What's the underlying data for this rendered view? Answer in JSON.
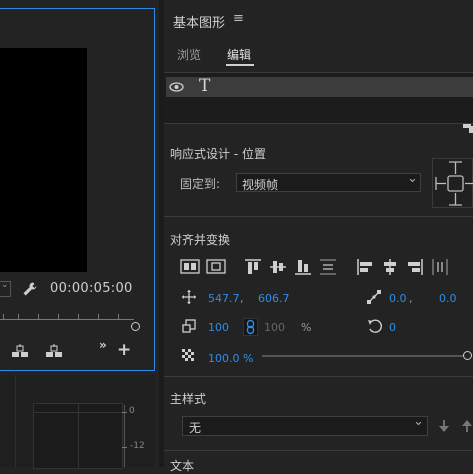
{
  "program": {
    "timecode": "00:00:05:00",
    "zoom_selector": "",
    "more_icon": "chevrons-right-icon",
    "add_icon": "plus-icon"
  },
  "audio_meter": {
    "ticks": [
      "0",
      "-12"
    ]
  },
  "panel": {
    "title": "基本图形",
    "menu_icon": "hamburger-icon",
    "tabs": [
      {
        "label": "浏览",
        "active": false
      },
      {
        "label": "编辑",
        "active": true
      }
    ],
    "layer": {
      "visibility_icon": "eye-icon",
      "type_icon": "text-type-icon"
    }
  },
  "responsive": {
    "heading": "响应式设计 - 位置",
    "pin_label": "固定到:",
    "pin_value": "视频帧"
  },
  "align": {
    "heading": "对齐并变换"
  },
  "transform": {
    "position_x": "547.7",
    "position_sep": ",",
    "position_y": "606.7",
    "anchor_x": "0.0",
    "anchor_sep": ",",
    "anchor_y": "0.0",
    "scale": "100",
    "scale_h": "100",
    "scale_unit": "%",
    "rotation": "0",
    "opacity": "100.0 %",
    "opacity_fraction": 1.0
  },
  "master_style": {
    "heading": "主样式",
    "value": "无"
  },
  "text_section": {
    "heading": "文本"
  },
  "colors": {
    "accent": "#2d8ceb",
    "panel_border": "#2d8ceb",
    "background": "#232323"
  }
}
